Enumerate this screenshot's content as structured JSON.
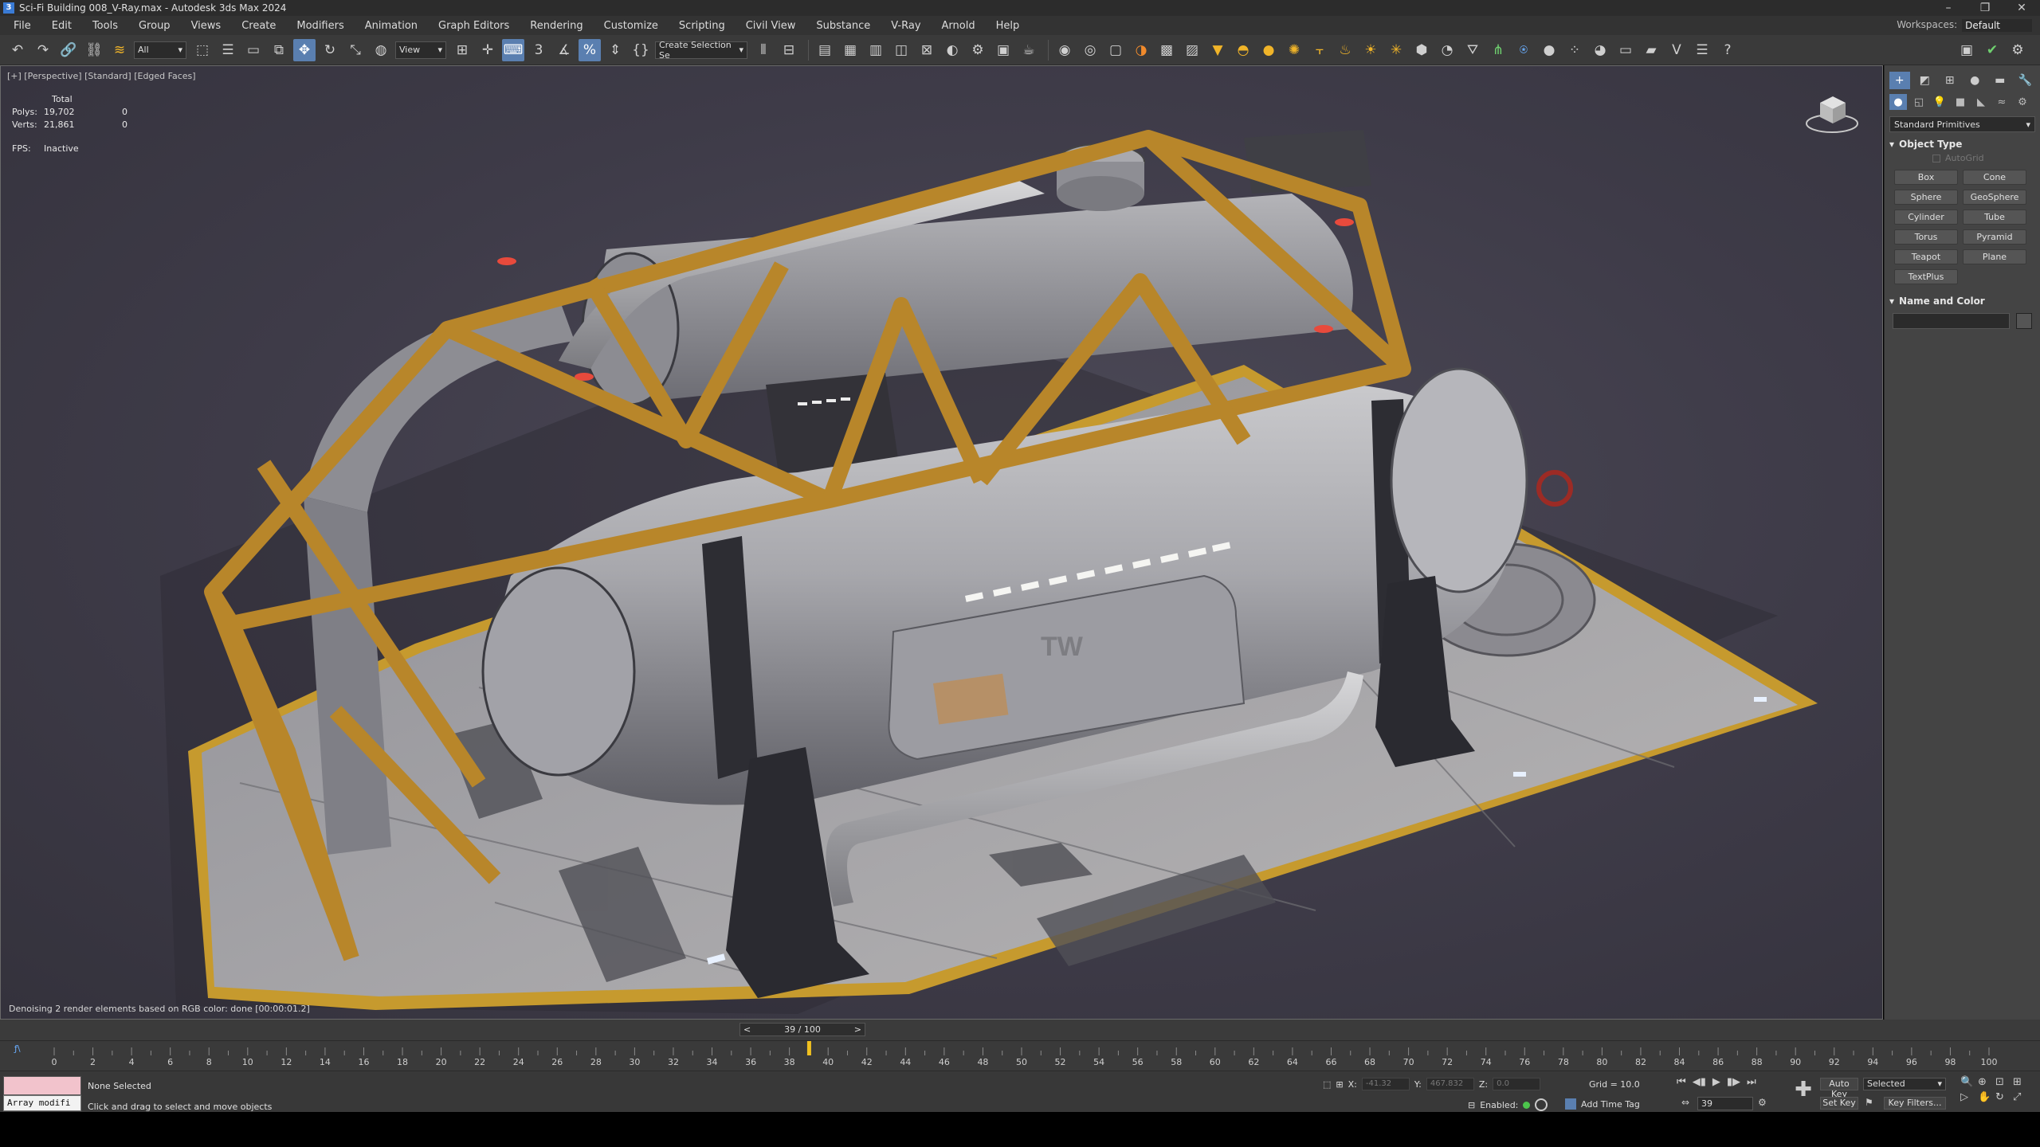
{
  "window": {
    "title": "Sci-Fi Building 008_V-Ray.max - Autodesk 3ds Max 2024",
    "app_icon": "3",
    "controls": [
      "minimize-icon",
      "restore-icon",
      "close-icon"
    ]
  },
  "menu": {
    "items": [
      "File",
      "Edit",
      "Tools",
      "Group",
      "Views",
      "Create",
      "Modifiers",
      "Animation",
      "Graph Editors",
      "Rendering",
      "Customize",
      "Scripting",
      "Civil View",
      "Substance",
      "V-Ray",
      "Arnold",
      "Help"
    ],
    "workspace_label": "Workspaces:",
    "workspace_value": "Default"
  },
  "toolbar": {
    "filter_value": "All",
    "refcoord_value": "View",
    "selection_set_value": "Create Selection Se",
    "accent": "#5a7fb0"
  },
  "viewport": {
    "label": "[+] [Perspective] [Standard] [Edged Faces]",
    "stats": {
      "header": "Total",
      "polys_label": "Polys:",
      "polys_value": "19,702",
      "polys_sel": "0",
      "verts_label": "Verts:",
      "verts_value": "21,861",
      "verts_sel": "0",
      "fps_label": "FPS:",
      "fps_value": "Inactive"
    },
    "denoise_message": "Denoising 2 render elements based on RGB color: done [00:00:01.2]",
    "model_decal": "TW"
  },
  "command_panel": {
    "category": "Standard Primitives",
    "object_type_header": "Object Type",
    "autogrid_label": "AutoGrid",
    "primitives": [
      "Box",
      "Cone",
      "Sphere",
      "GeoSphere",
      "Cylinder",
      "Tube",
      "Torus",
      "Pyramid",
      "Teapot",
      "Plane",
      "TextPlus"
    ],
    "name_color_header": "Name and Color"
  },
  "time_slider": {
    "frame_readout": "39 / 100",
    "current_frame": 39,
    "total_frames": 100
  },
  "timeline": {
    "ticks": [
      "0",
      "2",
      "4",
      "6",
      "8",
      "10",
      "12",
      "14",
      "16",
      "18",
      "20",
      "22",
      "24",
      "26",
      "28",
      "30",
      "32",
      "34",
      "36",
      "38",
      "40",
      "42",
      "44",
      "46",
      "48",
      "50",
      "52",
      "54",
      "56",
      "58",
      "60",
      "62",
      "64",
      "66",
      "68",
      "70",
      "72",
      "74",
      "76",
      "78",
      "80",
      "82",
      "84",
      "86",
      "88",
      "90",
      "92",
      "94",
      "96",
      "98",
      "100"
    ],
    "marker_color": "#f0c020"
  },
  "status": {
    "listener_text": "Array modifi",
    "selection_text": "None Selected",
    "prompt_text": "Click and drag to select and move objects",
    "x_label": "X:",
    "x_value": "-41.32",
    "y_label": "Y:",
    "y_value": "467.832",
    "z_label": "Z:",
    "z_value": "0.0",
    "grid_text": "Grid = 10.0",
    "enabled_label": "Enabled:",
    "add_time_tag": "Add Time Tag",
    "frame_value": "39",
    "auto_key": "Auto Key",
    "set_key": "Set Key",
    "key_mode_value": "Selected",
    "key_filters": "Key Filters..."
  }
}
